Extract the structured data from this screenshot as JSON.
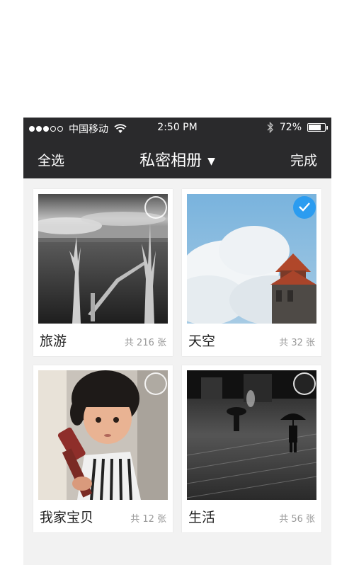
{
  "status_bar": {
    "carrier": "中国移动",
    "time": "2:50 PM",
    "battery_text": "72%",
    "battery_level": 0.72,
    "signal_bars_filled": 3,
    "signal_bars_total": 5
  },
  "nav": {
    "left_label": "全选",
    "title": "私密相册",
    "right_label": "完成"
  },
  "albums": [
    {
      "name": "旅游",
      "count": "共 216 张",
      "selected": false,
      "photo": "black-and-white lake with dead trees"
    },
    {
      "name": "天空",
      "count": "共 32 张",
      "selected": true,
      "photo": "blue sky with clouds and pagoda"
    },
    {
      "name": "我家宝贝",
      "count": "共 12 张",
      "selected": false,
      "photo": "little girl holding ukulele"
    },
    {
      "name": "生活",
      "count": "共 56 张",
      "selected": false,
      "photo": "black-and-white rainy street with umbrella"
    }
  ],
  "colors": {
    "bar_bg": "#2a2a2c",
    "content_bg": "#f2f2f2",
    "check_blue": "#2b9cf0"
  }
}
